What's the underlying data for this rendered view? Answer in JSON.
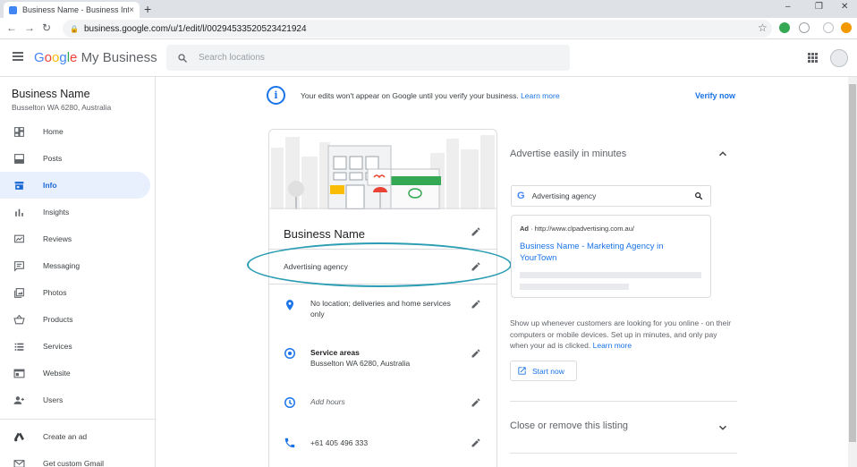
{
  "browser": {
    "tab_title": "Business Name - Business Info",
    "tab_close": "×",
    "new_tab": "+",
    "url": "business.google.com/u/1/edit/l/00294533520523421924",
    "window_controls": [
      "–",
      "❐",
      "✕"
    ]
  },
  "header": {
    "brand_google": [
      "G",
      "o",
      "o",
      "g",
      "l",
      "e"
    ],
    "brand_product": "My Business",
    "search_placeholder": "Search locations"
  },
  "sidebar": {
    "business_name": "Business Name",
    "business_address": "Busselton WA 6280, Australia",
    "items": [
      {
        "label": "Home",
        "icon": "dashboard-icon"
      },
      {
        "label": "Posts",
        "icon": "posts-icon"
      },
      {
        "label": "Info",
        "icon": "storefront-icon",
        "active": true
      },
      {
        "label": "Insights",
        "icon": "bar-chart-icon"
      },
      {
        "label": "Reviews",
        "icon": "rate-review-icon"
      },
      {
        "label": "Messaging",
        "icon": "message-icon"
      },
      {
        "label": "Photos",
        "icon": "photo-library-icon"
      },
      {
        "label": "Products",
        "icon": "basket-icon"
      },
      {
        "label": "Services",
        "icon": "list-icon"
      },
      {
        "label": "Website",
        "icon": "web-icon"
      },
      {
        "label": "Users",
        "icon": "person-add-icon"
      },
      {
        "label": "Create an ad",
        "icon": "google-ads-icon"
      },
      {
        "label": "Get custom Gmail",
        "icon": "gmail-icon"
      }
    ]
  },
  "banner": {
    "message": "Your edits won't appear on Google until you verify your business.",
    "learn_more": "Learn more",
    "verify_now": "Verify now"
  },
  "info_card": {
    "title": "Business Name",
    "category": "Advertising agency",
    "rows": [
      {
        "icon": "location-pin-icon",
        "text": "No location; deliveries and home services only"
      },
      {
        "icon": "service-area-icon",
        "title": "Service areas",
        "text": "Busselton WA 6280, Australia"
      },
      {
        "icon": "clock-icon",
        "text": "Add hours"
      },
      {
        "icon": "phone-icon",
        "text": "+61 405 496 333"
      }
    ]
  },
  "advertise": {
    "title": "Advertise easily in minutes",
    "search_g": "G",
    "search_query": "Advertising agency",
    "ad_label": "Ad",
    "ad_url": "· http://www.clpadvertising.com.au/",
    "ad_headline": "Business Name - Marketing Agency in YourTown",
    "description": "Show up whenever customers are looking for you online - on their computers or mobile devices. Set up in minutes, and only pay when your ad is clicked.",
    "learn_more": "Learn more",
    "start_now": "Start now"
  },
  "close_listing": {
    "title": "Close or remove this listing"
  },
  "colors": {
    "accent": "#1a73e8",
    "annotation_ellipse": "#2a9db3",
    "active_nav_bg": "#e8f0fe"
  }
}
